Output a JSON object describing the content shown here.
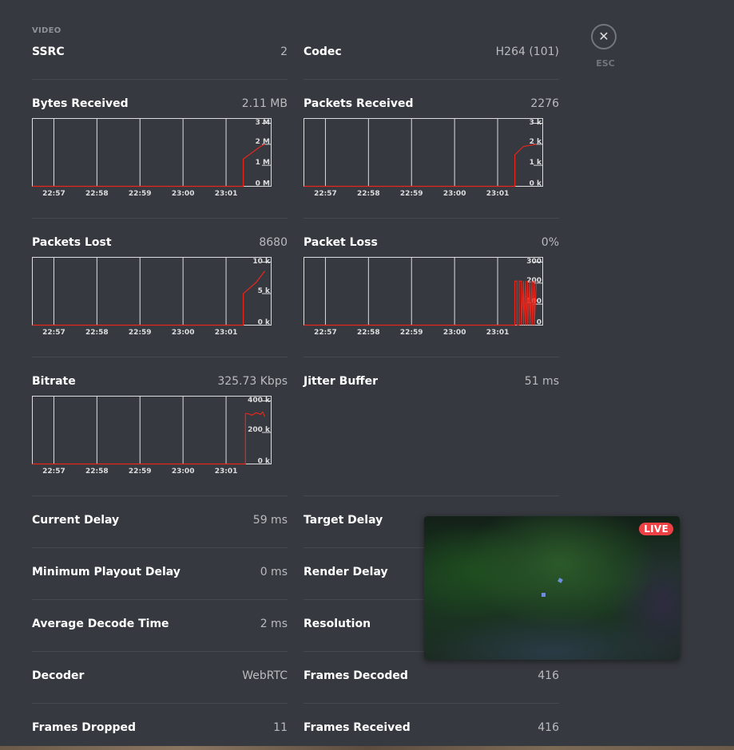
{
  "section": {
    "title": "VIDEO"
  },
  "close": {
    "icon": "close-icon",
    "label": "ESC"
  },
  "stats": {
    "ssrc": {
      "label": "SSRC",
      "value": "2"
    },
    "codec": {
      "label": "Codec",
      "value": "H264 (101)"
    },
    "bytes_received": {
      "label": "Bytes Received",
      "value": "2.11 MB"
    },
    "packets_received": {
      "label": "Packets Received",
      "value": "2276"
    },
    "packets_lost": {
      "label": "Packets Lost",
      "value": "8680"
    },
    "packet_loss": {
      "label": "Packet Loss",
      "value": "0%"
    },
    "bitrate": {
      "label": "Bitrate",
      "value": "325.73 Kbps"
    },
    "jitter_buffer": {
      "label": "Jitter Buffer",
      "value": "51 ms"
    },
    "current_delay": {
      "label": "Current Delay",
      "value": "59 ms"
    },
    "target_delay": {
      "label": "Target Delay",
      "value": ""
    },
    "min_playout_delay": {
      "label": "Minimum Playout Delay",
      "value": "0 ms"
    },
    "render_delay": {
      "label": "Render Delay",
      "value": ""
    },
    "avg_decode_time": {
      "label": "Average Decode Time",
      "value": "2 ms"
    },
    "resolution": {
      "label": "Resolution",
      "value": ""
    },
    "decoder": {
      "label": "Decoder",
      "value": "WebRTC"
    },
    "frames_decoded": {
      "label": "Frames Decoded",
      "value": "416"
    },
    "frames_dropped": {
      "label": "Frames Dropped",
      "value": "11"
    },
    "frames_received": {
      "label": "Frames Received",
      "value": "416"
    }
  },
  "preview": {
    "live_badge": "LIVE"
  },
  "colors": {
    "line": "#e8261c",
    "grid": "#dcddde",
    "background": "#36393f"
  },
  "chart_data": [
    {
      "id": "bytes",
      "type": "line",
      "x_ticks": [
        "22:57",
        "22:58",
        "22:59",
        "23:00",
        "23:01"
      ],
      "y_ticks": [
        {
          "v": 0,
          "t": "0 M"
        },
        {
          "v": 1,
          "t": "1 M"
        },
        {
          "v": 2,
          "t": "2 M"
        },
        {
          "v": 3,
          "t": "3 M"
        }
      ],
      "ylim": [
        0,
        3
      ],
      "xlim": [
        0,
        5
      ],
      "series": [
        {
          "x": [
            0,
            4.9,
            4.9,
            5.3,
            5.4
          ],
          "y": [
            0,
            0,
            1.3,
            1.9,
            2.0
          ]
        }
      ]
    },
    {
      "id": "packets_received",
      "type": "line",
      "x_ticks": [
        "22:57",
        "22:58",
        "22:59",
        "23:00",
        "23:01"
      ],
      "y_ticks": [
        {
          "v": 0,
          "t": "0 k"
        },
        {
          "v": 1,
          "t": "1 k"
        },
        {
          "v": 2,
          "t": "2 k"
        },
        {
          "v": 3,
          "t": "3 k"
        }
      ],
      "ylim": [
        0,
        3
      ],
      "xlim": [
        0,
        5
      ],
      "series": [
        {
          "x": [
            0,
            4.9,
            4.9,
            5.1,
            5.4
          ],
          "y": [
            0,
            0,
            1.5,
            1.9,
            2.0
          ]
        }
      ]
    },
    {
      "id": "packets_lost",
      "type": "line",
      "x_ticks": [
        "22:57",
        "22:58",
        "22:59",
        "23:00",
        "23:01"
      ],
      "y_ticks": [
        {
          "v": 0,
          "t": "0 k"
        },
        {
          "v": 5,
          "t": "5 k"
        },
        {
          "v": 10,
          "t": "10 k"
        }
      ],
      "ylim": [
        0,
        10
      ],
      "xlim": [
        0,
        5
      ],
      "series": [
        {
          "x": [
            0,
            4.9,
            4.9,
            5.2,
            5.4
          ],
          "y": [
            0,
            0,
            5.0,
            6.8,
            8.6
          ]
        }
      ]
    },
    {
      "id": "packet_loss",
      "type": "line",
      "x_ticks": [
        "22:57",
        "22:58",
        "22:59",
        "23:00",
        "23:01"
      ],
      "y_ticks": [
        {
          "v": 0,
          "t": "0"
        },
        {
          "v": 100,
          "t": "100"
        },
        {
          "v": 200,
          "t": "200"
        },
        {
          "v": 300,
          "t": "300"
        }
      ],
      "ylim": [
        0,
        300
      ],
      "xlim": [
        0,
        5
      ],
      "series": [
        {
          "x": [
            0,
            4.9,
            4.9,
            4.95,
            4.95,
            5.0,
            5.0,
            5.05,
            5.05,
            5.1,
            5.1,
            5.15,
            5.15,
            5.2,
            5.2,
            5.25,
            5.25,
            5.3,
            5.3,
            5.35,
            5.35,
            5.4
          ],
          "y": [
            0,
            0,
            210,
            210,
            0,
            0,
            210,
            210,
            0,
            210,
            0,
            210,
            0,
            210,
            0,
            210,
            0,
            210,
            0,
            210,
            0,
            210
          ]
        }
      ]
    },
    {
      "id": "bitrate",
      "type": "line",
      "x_ticks": [
        "22:57",
        "22:58",
        "22:59",
        "23:00",
        "23:01"
      ],
      "y_ticks": [
        {
          "v": 0,
          "t": "0 k"
        },
        {
          "v": 200,
          "t": "200 k"
        },
        {
          "v": 400,
          "t": "400 k"
        }
      ],
      "ylim": [
        0,
        400
      ],
      "xlim": [
        0,
        5
      ],
      "series": [
        {
          "x": [
            0,
            4.95,
            4.95,
            5.0,
            5.1,
            5.2,
            5.3,
            5.35,
            5.4
          ],
          "y": [
            0,
            0,
            320,
            320,
            310,
            325,
            315,
            330,
            300
          ]
        }
      ]
    }
  ]
}
